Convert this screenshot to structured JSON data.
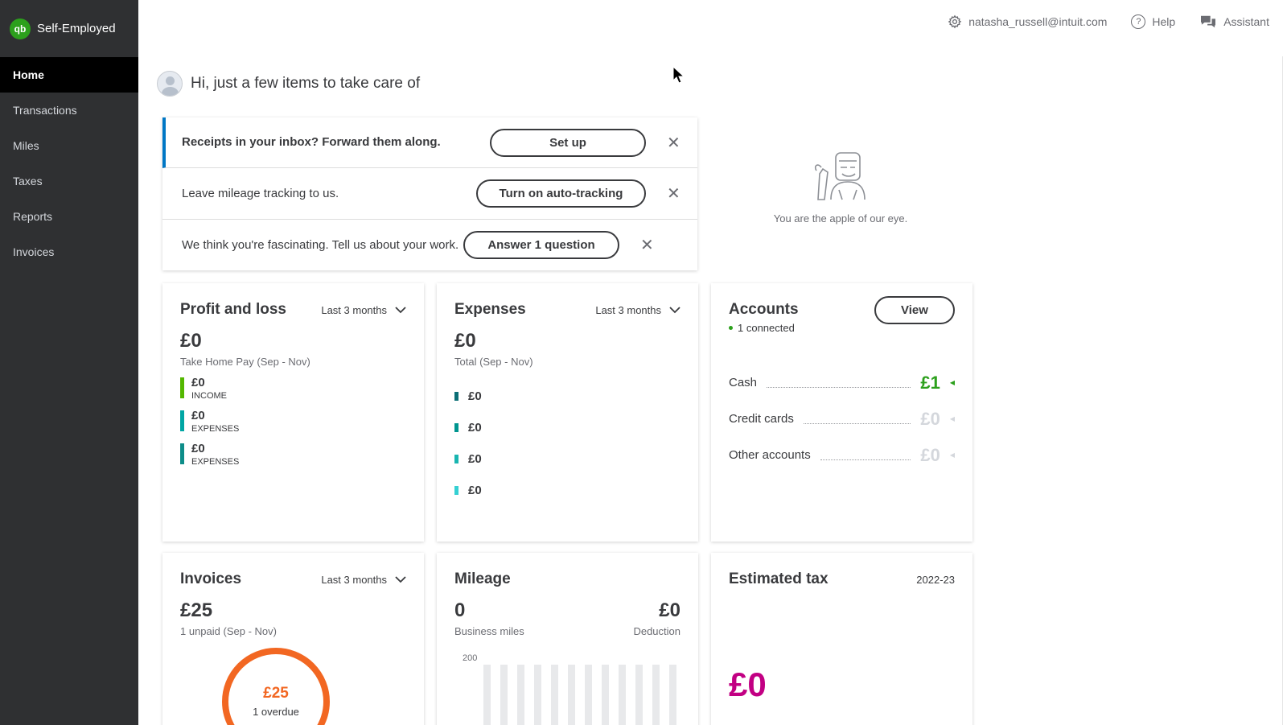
{
  "brand": {
    "name": "Self-Employed",
    "logo": "qb"
  },
  "nav": [
    {
      "label": "Home",
      "active": true
    },
    {
      "label": "Transactions"
    },
    {
      "label": "Miles"
    },
    {
      "label": "Taxes"
    },
    {
      "label": "Reports"
    },
    {
      "label": "Invoices"
    }
  ],
  "topbar": {
    "user": "natasha_russell@intuit.com",
    "help": "Help",
    "assistant": "Assistant",
    "help_glyph": "?"
  },
  "greeting": "Hi, just a few items to take care of",
  "tasks": [
    {
      "text": "Receipts in your inbox? Forward them along.",
      "button": "Set up"
    },
    {
      "text": "Leave mileage tracking to us.",
      "button": "Turn on auto-tracking"
    },
    {
      "text": "We think you're fascinating. Tell us about your work.",
      "button": "Answer 1 question"
    }
  ],
  "close_glyph": "✕",
  "aside_message": "You are the apple of our eye.",
  "profit_loss": {
    "title": "Profit and loss",
    "period": "Last 3 months",
    "amount": "£0",
    "subtitle": "Take Home Pay (Sep - Nov)",
    "rows": [
      {
        "value": "£0",
        "label": "INCOME",
        "color": "#53b700"
      },
      {
        "value": "£0",
        "label": "EXPENSES",
        "color": "#00a6a4"
      },
      {
        "value": "£0",
        "label": "EXPENSES",
        "color": "#0d8d89"
      }
    ]
  },
  "expenses": {
    "title": "Expenses",
    "period": "Last 3 months",
    "amount": "£0",
    "subtitle": "Total (Sep - Nov)",
    "rows": [
      {
        "value": "£0",
        "color": "#0b6e75"
      },
      {
        "value": "£0",
        "color": "#00958f"
      },
      {
        "value": "£0",
        "color": "#19b5b0"
      },
      {
        "value": "£0",
        "color": "#35d0d3"
      }
    ]
  },
  "accounts": {
    "title": "Accounts",
    "view_button": "View",
    "connected": "1 connected",
    "rows": [
      {
        "label": "Cash",
        "value": "£1",
        "color": "#2ca01c"
      },
      {
        "label": "Credit cards",
        "value": "£0",
        "color": "#d4d7dc"
      },
      {
        "label": "Other accounts",
        "value": "£0",
        "color": "#d4d7dc"
      }
    ]
  },
  "invoices": {
    "title": "Invoices",
    "period": "Last 3 months",
    "amount": "£25",
    "subtitle": "1 unpaid (Sep - Nov)",
    "donut_amount": "£25",
    "donut_sub": "1 overdue"
  },
  "mileage": {
    "title": "Mileage",
    "miles": "0",
    "miles_label": "Business miles",
    "deduction": "£0",
    "deduction_label": "Deduction",
    "axis_tick": "200"
  },
  "estimated_tax": {
    "title": "Estimated tax",
    "year": "2022-23",
    "amount": "£0"
  },
  "icons": {
    "settings": "gear-icon",
    "help": "question-circle-icon",
    "assistant": "chat-bubbles-icon",
    "dropdown": "chevron-down-icon",
    "close": "close-icon"
  },
  "colors": {
    "sidebar_bg": "#2f3032",
    "active_nav": "#000000",
    "accent_blue": "#0077c5",
    "qb_green": "#2ca01c",
    "invoice_orange": "#f26722",
    "tax_magenta": "#c20083"
  }
}
